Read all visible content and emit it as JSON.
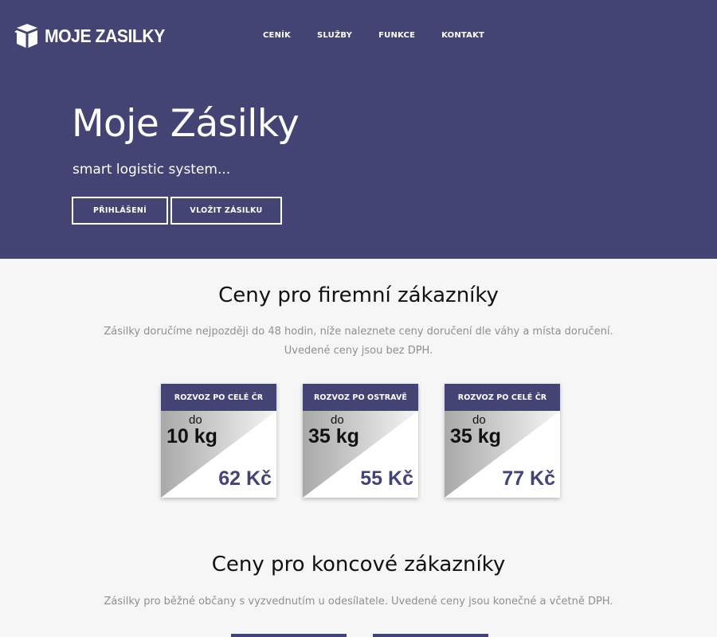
{
  "brand": {
    "logo_text": "MOJE ZASILKY"
  },
  "nav": {
    "items": [
      "CENÍK",
      "SLUŽBY",
      "FUNKCE",
      "KONTAKT"
    ]
  },
  "hero": {
    "title": "Moje Zásilky",
    "subtitle": "smart logistic system...",
    "login_label": "PŘIHLÁŠENÍ",
    "insert_label": "VLOŽIT ZÁSILKU"
  },
  "business": {
    "title": "Ceny pro firemní zákazníky",
    "line1": "Zásilky doručíme nejpozději do 48 hodin, níže naleznete ceny doručení dle váhy a místa doručení.",
    "line2": "Uvedené ceny jsou bez DPH.",
    "cards": [
      {
        "header": "ROZVOZ PO CELÉ ČR",
        "prefix": "do",
        "weight": "10 kg",
        "price": "62 Kč"
      },
      {
        "header": "ROZVOZ PO OSTRAVĚ",
        "prefix": "do",
        "weight": "35 kg",
        "price": "55 Kč"
      },
      {
        "header": "ROZVOZ PO CELÉ ČR",
        "prefix": "do",
        "weight": "35 kg",
        "price": "77 Kč"
      }
    ]
  },
  "consumer": {
    "title": "Ceny pro koncové zákazníky",
    "line1": "Zásilky pro běžné občany s vyzvednutím u odesílatele. Uvedené ceny jsou konečné a včetně DPH."
  },
  "colors": {
    "primary": "#434374",
    "background": "#f6f6f6",
    "muted_text": "#8f8f8f"
  },
  "icons": {
    "logo": "open-box-icon"
  }
}
